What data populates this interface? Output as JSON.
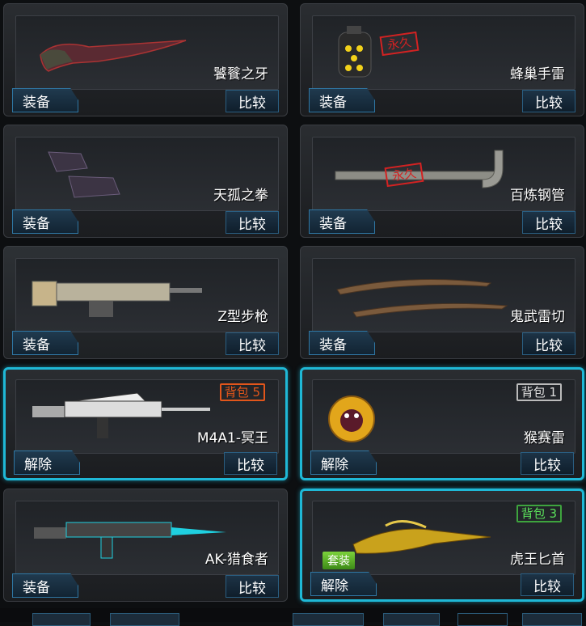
{
  "cards": [
    {
      "name": "饕餮之牙",
      "button": "装备",
      "compare": "比较",
      "selected": false,
      "weapon": "curved-blade-icon"
    },
    {
      "name": "蜂巢手雷",
      "button": "装备",
      "compare": "比较",
      "selected": false,
      "weapon": "grenade-icon",
      "stamp": "永久"
    },
    {
      "name": "天孤之拳",
      "button": "装备",
      "compare": "比较",
      "selected": false,
      "weapon": "gauntlet-icon"
    },
    {
      "name": "百炼钢管",
      "button": "装备",
      "compare": "比较",
      "selected": false,
      "weapon": "pipe-icon",
      "stamp": "永久"
    },
    {
      "name": "Z型步枪",
      "button": "装备",
      "compare": "比较",
      "selected": false,
      "weapon": "rifle-icon"
    },
    {
      "name": "鬼武雷切",
      "button": "装备",
      "compare": "比较",
      "selected": false,
      "weapon": "dual-sword-icon"
    },
    {
      "name": "M4A1-冥王",
      "button": "解除",
      "compare": "比较",
      "selected": true,
      "weapon": "assault-rifle-icon",
      "badge": "背包 5",
      "badge_color": "orange"
    },
    {
      "name": "猴赛雷",
      "button": "解除",
      "compare": "比较",
      "selected": true,
      "weapon": "monkey-grenade-icon",
      "badge": "背包 1",
      "badge_color": "gray"
    },
    {
      "name": "AK-猎食者",
      "button": "装备",
      "compare": "比较",
      "selected": false,
      "weapon": "ak-rifle-icon"
    },
    {
      "name": "虎王匕首",
      "button": "解除",
      "compare": "比较",
      "selected": true,
      "weapon": "tiger-dagger-icon",
      "badge": "背包 3",
      "badge_color": "green",
      "suit": "套装"
    }
  ]
}
